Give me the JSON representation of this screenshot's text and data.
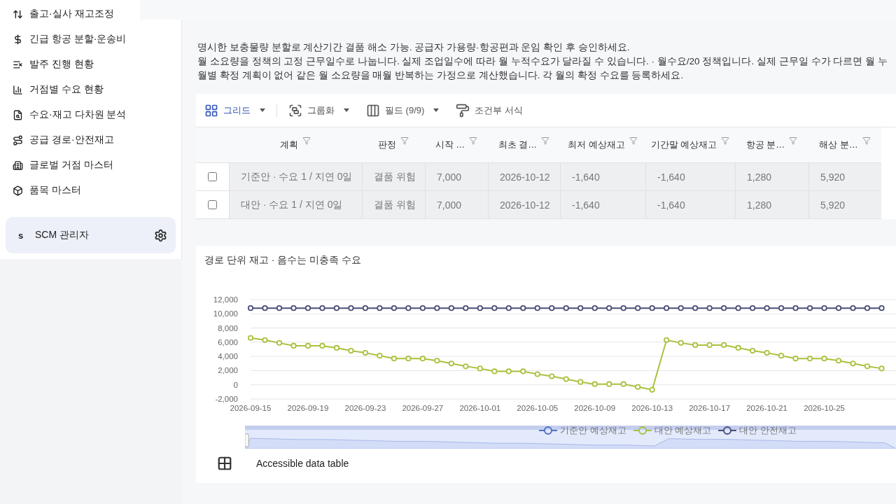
{
  "sidebar": {
    "items": [
      {
        "label": "출고·실사 재고조정"
      },
      {
        "label": "긴급 항공 분할·운송비"
      },
      {
        "label": "발주 진행 현황"
      },
      {
        "label": "거점별 수요 현황"
      },
      {
        "label": "수요·재고 다차원 분석"
      },
      {
        "label": "공급 경로·안전재고"
      },
      {
        "label": "글로벌 거점 마스터"
      },
      {
        "label": "품목 마스터"
      }
    ],
    "user": {
      "initial": "s",
      "name": "SCM 관리자"
    }
  },
  "notes": [
    "명시한 보충물량 분할로 계산기간 결품 해소 가능. 공급자 가용량·항공편과 운임 확인 후 승인하세요.",
    "월 소요량을 정책의 고정 근무일수로 나눕니다. 실제 조업일수에 따라 월 누적수요가 달라질 수 있습니다. · 월수요/20 정책입니다. 실제 근무일 수가 다르면 월 누",
    "월별 확정 계획이 없어 같은 월 소요량을 매월 반복하는 가정으로 계산했습니다. 각 월의 확정 수요를 등록하세요."
  ],
  "toolbar": [
    {
      "label": "그리드",
      "selected": true,
      "kind": "dropdown"
    },
    {
      "label": "그룹화",
      "selected": false,
      "kind": "dropdown"
    },
    {
      "label": "필드 (9/9)",
      "selected": false,
      "kind": "dropdown"
    },
    {
      "label": "조건부 서식",
      "selected": false,
      "kind": "button"
    }
  ],
  "table": {
    "columns": [
      "계획",
      "판정",
      "시작 …",
      "최초 결…",
      "최저 예상재고",
      "기간말 예상재고",
      "항공 분…",
      "해상 분…"
    ],
    "rows": [
      {
        "checked": false,
        "cells": [
          "기준안 · 수요 1 / 지연 0일",
          "결품 위험",
          "7,000",
          "2026-10-12",
          "-1,640",
          "-1,640",
          "1,280",
          "5,920"
        ]
      },
      {
        "checked": false,
        "cells": [
          "대안 · 수요 1 / 지연 0일",
          "결품 위험",
          "7,000",
          "2026-10-12",
          "-1,640",
          "-1,640",
          "1,280",
          "5,920"
        ]
      }
    ]
  },
  "chart": {
    "title": "경로 단위 재고 · 음수는 미충족 수요",
    "accessible_table": "Accessible data table",
    "zoom": {
      "level": 1
    },
    "chart_data": {
      "type": "line",
      "grid": true,
      "x": [
        "2026-09-15",
        "2026-09-16",
        "2026-09-17",
        "2026-09-18",
        "2026-09-19",
        "2026-09-20",
        "2026-09-21",
        "2026-09-22",
        "2026-09-23",
        "2026-09-24",
        "2026-09-25",
        "2026-09-26",
        "2026-09-27",
        "2026-09-28",
        "2026-09-29",
        "2026-09-30",
        "2026-10-01",
        "2026-10-02",
        "2026-10-03",
        "2026-10-04",
        "2026-10-05",
        "2026-10-06",
        "2026-10-07",
        "2026-10-08",
        "2026-10-09",
        "2026-10-10",
        "2026-10-11",
        "2026-10-12",
        "2026-10-13",
        "2026-10-14",
        "2026-10-15",
        "2026-10-16",
        "2026-10-17",
        "2026-10-18",
        "2026-10-19",
        "2026-10-20",
        "2026-10-21",
        "2026-10-22",
        "2026-10-23",
        "2026-10-24",
        "2026-10-25",
        "2026-10-26",
        "2026-10-27",
        "2026-10-28",
        "2026-10-29"
      ],
      "xticks": [
        "2026-09-15",
        "2026-09-19",
        "2026-09-23",
        "2026-09-27",
        "2026-10-01",
        "2026-10-05",
        "2026-10-09",
        "2026-10-13",
        "2026-10-17",
        "2026-10-21",
        "2026-10-25"
      ],
      "yticks": [
        {
          "value": -2000,
          "label": "-2,000"
        },
        {
          "value": 0,
          "label": "0"
        },
        {
          "value": 2000,
          "label": "2,000"
        },
        {
          "value": 4000,
          "label": "4,000"
        },
        {
          "value": 6000,
          "label": "6,000"
        },
        {
          "value": 8000,
          "label": "8,000"
        },
        {
          "value": 10000,
          "label": "10,000"
        },
        {
          "value": 12000,
          "label": "12,000"
        }
      ],
      "ylim": [
        -2000,
        12000
      ],
      "xlim": [
        "2026-09-15",
        "2026-10-30"
      ],
      "series": [
        {
          "name": "기준안 예상재고",
          "color": "#5470c6",
          "marker": true,
          "values": [
            null,
            null,
            null,
            null,
            null,
            null,
            null,
            null,
            null,
            null,
            null,
            null,
            null,
            null,
            null,
            null,
            null,
            null,
            null,
            null,
            null,
            null,
            null,
            null,
            null,
            null,
            null,
            null,
            null,
            null,
            null,
            null,
            null,
            null,
            null,
            null,
            null,
            null,
            null,
            null,
            null,
            null,
            null,
            null,
            null
          ]
        },
        {
          "name": "대안 예상재고",
          "color": "#a9c23f",
          "marker": true,
          "values": [
            6600,
            6300,
            5900,
            5500,
            5500,
            5500,
            5200,
            4800,
            4500,
            4100,
            3700,
            3700,
            3700,
            3400,
            3000,
            2600,
            2300,
            1900,
            1900,
            1900,
            1500,
            1200,
            800,
            400,
            100,
            100,
            100,
            -300,
            -700,
            6300,
            5900,
            5600,
            5600,
            5600,
            5200,
            4800,
            4500,
            4100,
            3700,
            3700,
            3700,
            3400,
            3000,
            2600,
            2300
          ]
        },
        {
          "name": "대안 안전재고",
          "color": "#4b4f76",
          "marker": true,
          "values": [
            10800,
            10800,
            10800,
            10800,
            10800,
            10800,
            10800,
            10800,
            10800,
            10800,
            10800,
            10800,
            10800,
            10800,
            10800,
            10800,
            10800,
            10800,
            10800,
            10800,
            10800,
            10800,
            10800,
            10800,
            10800,
            10800,
            10800,
            10800,
            10800,
            10800,
            10800,
            10800,
            10800,
            10800,
            10800,
            10800,
            10800,
            10800,
            10800,
            10800,
            10800,
            10800,
            10800,
            10800,
            10800
          ]
        }
      ]
    }
  }
}
